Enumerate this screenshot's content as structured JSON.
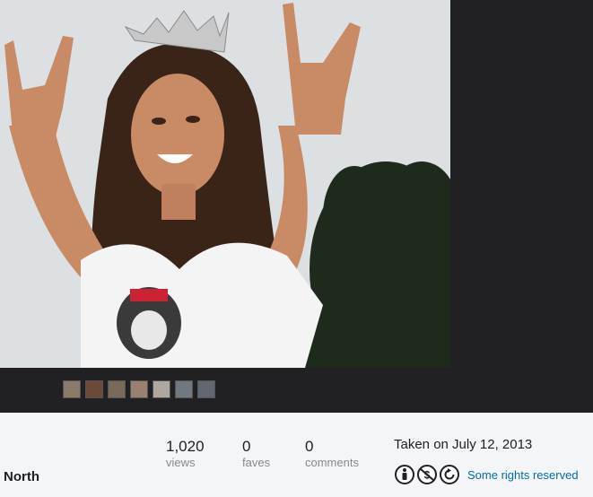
{
  "photo": {
    "alt_icon": "photo-woman-crown"
  },
  "filmstrip": {
    "thumbnail_count": 7,
    "thumb_colors": [
      "#8a7a6a",
      "#6b4a3a",
      "#7a6a5a",
      "#9a8070",
      "#b0a8a0",
      "#707880",
      "#606870"
    ]
  },
  "author": {
    "name": "North"
  },
  "stats": {
    "views": {
      "value": "1,020",
      "label": "views"
    },
    "faves": {
      "value": "0",
      "label": "faves"
    },
    "comments": {
      "value": "0",
      "label": "comments"
    }
  },
  "taken": {
    "text": "Taken on July 12, 2013"
  },
  "license": {
    "icons": [
      "attribution-icon",
      "noncommercial-icon",
      "sharealike-icon"
    ],
    "label": "Some rights reserved",
    "link_color": "#006dac"
  }
}
